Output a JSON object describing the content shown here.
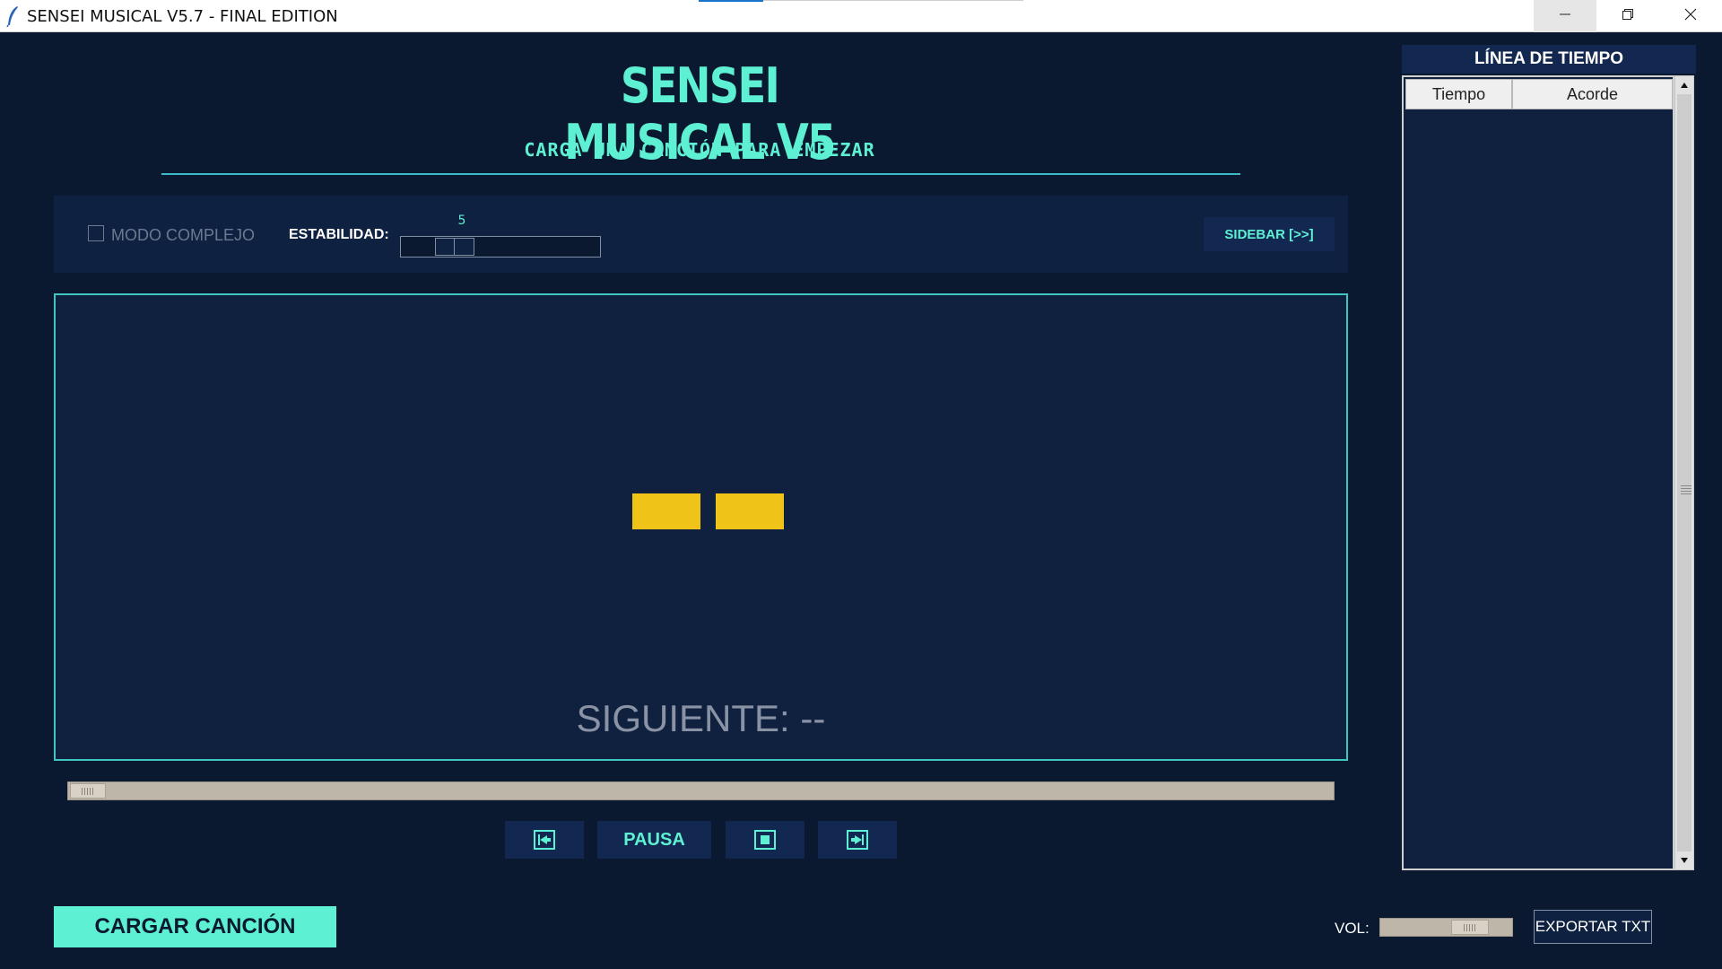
{
  "window": {
    "title": "SENSEI MUSICAL V5.7 - FINAL EDITION",
    "minimize_icon": "minimize-icon",
    "maximize_icon": "restore-icon",
    "close_icon": "close-icon"
  },
  "header": {
    "title": "SENSEI MUSICAL V5",
    "subtitle": "CARGA UNA CANCIÓN PARA EMPEZAR"
  },
  "controls": {
    "complex_mode_label": "MODO COMPLEJO",
    "complex_mode_checked": false,
    "stability_label": "ESTABILIDAD:",
    "stability_value": "5",
    "sidebar_button": "SIDEBAR [>>]"
  },
  "display": {
    "current_chord_placeholder": "▬ ▬",
    "next_label": "SIGUIENTE: --",
    "bar_color": "#efc318"
  },
  "progress": {
    "position_fraction": 0.0
  },
  "transport": {
    "prev_icon": "skip-back-icon",
    "pause_label": "PAUSA",
    "stop_icon": "stop-icon",
    "next_icon": "skip-forward-icon"
  },
  "footer": {
    "load_button": "CARGAR CANCIÓN",
    "volume_label": "VOL:",
    "volume_fraction": 0.75,
    "export_button": "EXPORTAR TXT"
  },
  "sidebar": {
    "title": "LÍNEA DE TIEMPO",
    "columns": [
      "Tiempo",
      "Acorde"
    ],
    "rows": []
  },
  "colors": {
    "background": "#0a1930",
    "accent": "#5ef0d2",
    "panel": "#10213f",
    "border_accent": "#3fc6c0"
  }
}
